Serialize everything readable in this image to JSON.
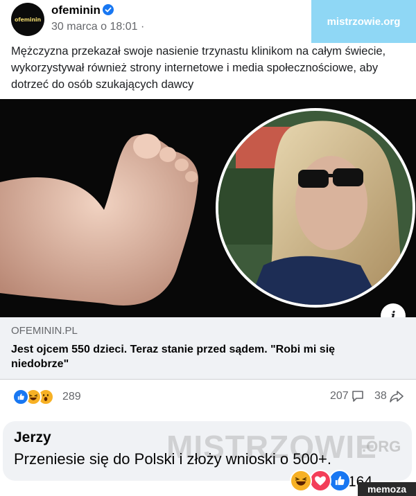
{
  "header": {
    "page_name": "ofeminin",
    "avatar_text": "ofeminin",
    "time": "30 marca o 18:01 ·"
  },
  "watermark_top": "mistrzowie.org",
  "post": {
    "text": "Mężczyzna przekazał swoje nasienie trzynastu klinikom na całym świecie, wykorzystywał również strony internetowe i media społecznościowe, aby dotrzeć do osób szukających dawcy"
  },
  "link": {
    "domain": "OFEMININ.PL",
    "title": "Jest ojcem 550 dzieci. Teraz stanie przed sądem. \"Robi mi się niedobrze\"",
    "info_icon_label": "i"
  },
  "reactions": {
    "count": "289",
    "comments": "207",
    "shares": "38",
    "icons": [
      "like-icon",
      "haha-icon",
      "wow-icon"
    ]
  },
  "comment": {
    "author": "Jerzy",
    "text": "Przeniesie się do Polski i złoży wnioski o 500+.",
    "reaction_count": "164"
  },
  "watermarks": {
    "center": "MISTRZOWIE",
    "center_org": ".ORG",
    "corner": "memoza"
  },
  "colors": {
    "accent": "#1877f2",
    "watermark_bg": "#8fd7f5",
    "link_bg": "#f0f2f5",
    "meta_text": "#65676b"
  }
}
